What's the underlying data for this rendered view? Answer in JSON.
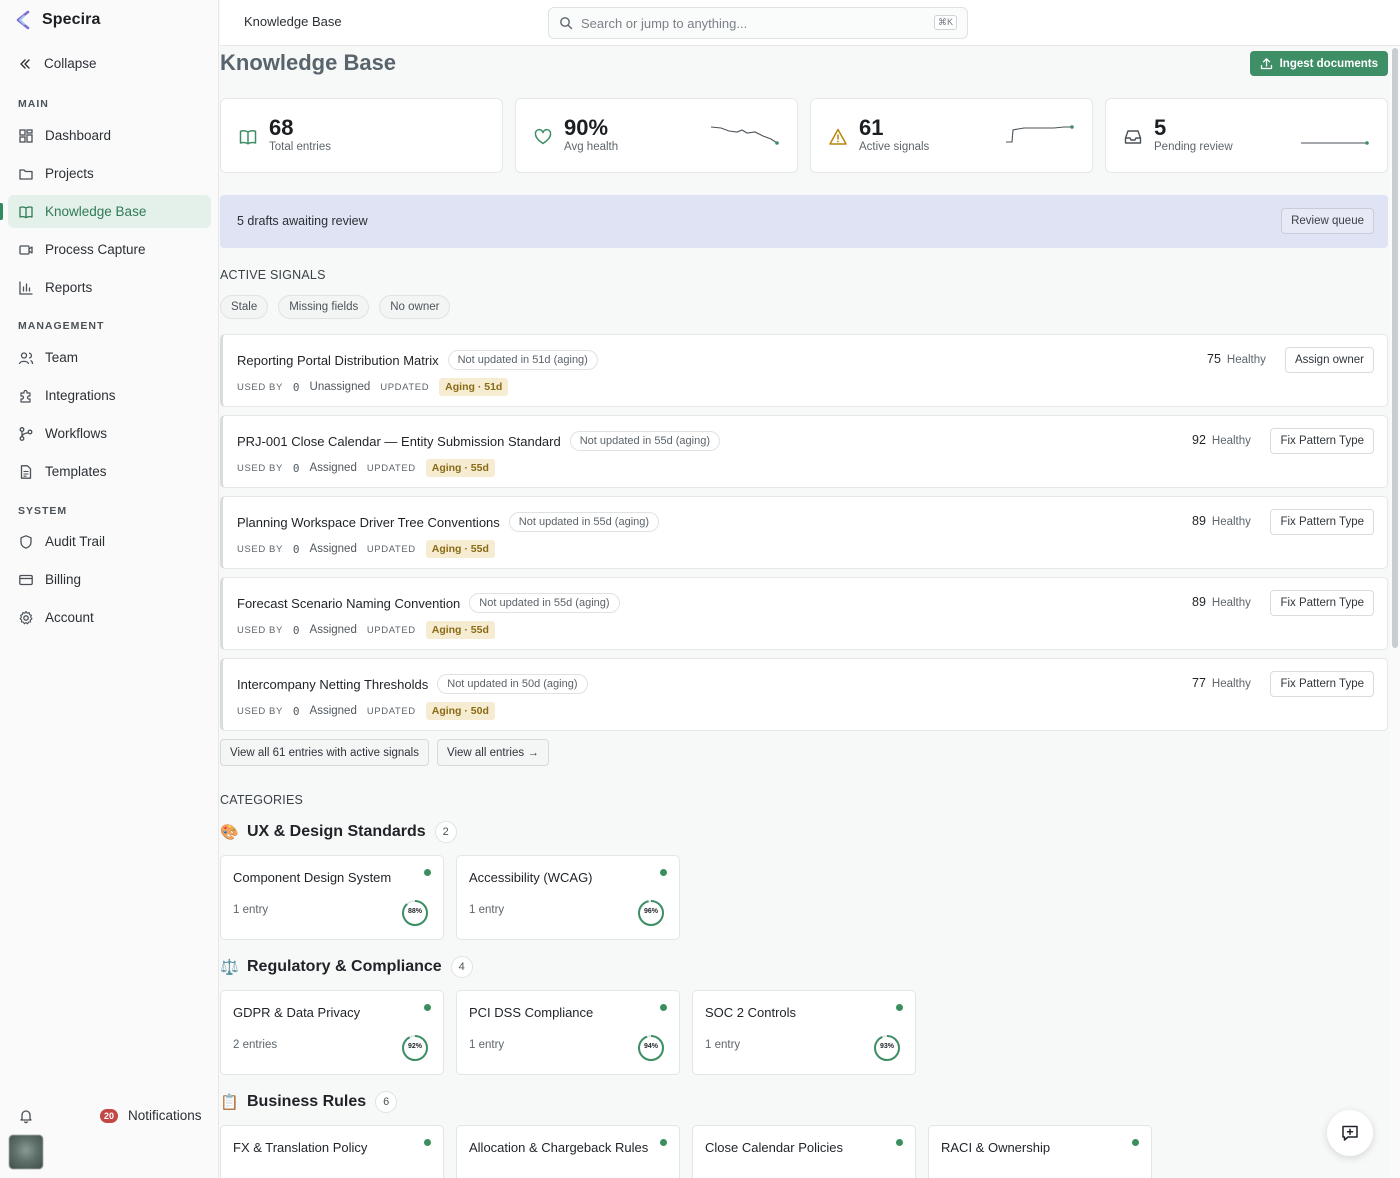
{
  "brand": {
    "name": "Specira"
  },
  "sidebar": {
    "collapse_label": "Collapse",
    "sections": {
      "main": "MAIN",
      "management": "MANAGEMENT",
      "system": "SYSTEM"
    },
    "items": [
      {
        "label": "Dashboard",
        "icon": "dashboard-icon"
      },
      {
        "label": "Projects",
        "icon": "folder-icon"
      },
      {
        "label": "Knowledge Base",
        "icon": "book-icon",
        "active": true
      },
      {
        "label": "Process Capture",
        "icon": "video-icon"
      },
      {
        "label": "Reports",
        "icon": "bar-chart-icon"
      },
      {
        "label": "Team",
        "icon": "users-icon"
      },
      {
        "label": "Integrations",
        "icon": "puzzle-icon"
      },
      {
        "label": "Workflows",
        "icon": "workflow-icon"
      },
      {
        "label": "Templates",
        "icon": "document-icon"
      },
      {
        "label": "Audit Trail",
        "icon": "shield-icon"
      },
      {
        "label": "Billing",
        "icon": "credit-card-icon"
      },
      {
        "label": "Account",
        "icon": "gear-icon"
      }
    ],
    "notifications": {
      "count": "20",
      "label": "Notifications"
    }
  },
  "topbar": {
    "breadcrumb": "Knowledge Base",
    "search_placeholder": "Search or jump to anything...",
    "search_shortcut": "⌘K"
  },
  "page": {
    "title": "Knowledge Base",
    "ingest_label": "Ingest documents"
  },
  "stats": [
    {
      "value": "68",
      "label": "Total entries",
      "icon": "book-icon"
    },
    {
      "value": "90%",
      "label": "Avg health",
      "icon": "heart-icon"
    },
    {
      "value": "61",
      "label": "Active signals",
      "icon": "warning-icon"
    },
    {
      "value": "5",
      "label": "Pending review",
      "icon": "inbox-icon"
    }
  ],
  "banner": {
    "text": "5 drafts awaiting review",
    "button": "Review queue"
  },
  "signals": {
    "heading": "ACTIVE SIGNALS",
    "filters": [
      "Stale",
      "Missing fields",
      "No owner"
    ],
    "used_by_label": "USED BY",
    "updated_label": "UPDATED",
    "rows": [
      {
        "title": "Reporting Portal Distribution Matrix",
        "pill": "Not updated in 51d (aging)",
        "used_by": "0",
        "owner": "Unassigned",
        "age": "Aging · 51d",
        "score": "75",
        "health": "Healthy",
        "action": "Assign owner"
      },
      {
        "title": "PRJ-001 Close Calendar — Entity Submission Standard",
        "pill": "Not updated in 55d (aging)",
        "used_by": "0",
        "owner": "Assigned",
        "age": "Aging · 55d",
        "score": "92",
        "health": "Healthy",
        "action": "Fix Pattern Type"
      },
      {
        "title": "Planning Workspace Driver Tree Conventions",
        "pill": "Not updated in 55d (aging)",
        "used_by": "0",
        "owner": "Assigned",
        "age": "Aging · 55d",
        "score": "89",
        "health": "Healthy",
        "action": "Fix Pattern Type"
      },
      {
        "title": "Forecast Scenario Naming Convention",
        "pill": "Not updated in 55d (aging)",
        "used_by": "0",
        "owner": "Assigned",
        "age": "Aging · 55d",
        "score": "89",
        "health": "Healthy",
        "action": "Fix Pattern Type"
      },
      {
        "title": "Intercompany Netting Thresholds",
        "pill": "Not updated in 50d (aging)",
        "used_by": "0",
        "owner": "Assigned",
        "age": "Aging · 50d",
        "score": "77",
        "health": "Healthy",
        "action": "Fix Pattern Type"
      }
    ],
    "view_signals": "View all 61 entries with active signals",
    "view_all": "View all entries →"
  },
  "categories": {
    "heading": "CATEGORIES",
    "groups": [
      {
        "emoji": "🎨",
        "name": "UX & Design Standards",
        "count": "2",
        "cards": [
          {
            "name": "Component Design System",
            "entries": "1 entry",
            "health": "88%",
            "pct": 88
          },
          {
            "name": "Accessibility (WCAG)",
            "entries": "1 entry",
            "health": "96%",
            "pct": 96
          }
        ]
      },
      {
        "emoji": "⚖️",
        "name": "Regulatory & Compliance",
        "count": "4",
        "cards": [
          {
            "name": "GDPR & Data Privacy",
            "entries": "2 entries",
            "health": "92%",
            "pct": 92
          },
          {
            "name": "PCI DSS Compliance",
            "entries": "1 entry",
            "health": "94%",
            "pct": 94
          },
          {
            "name": "SOC 2 Controls",
            "entries": "1 entry",
            "health": "93%",
            "pct": 93
          }
        ]
      },
      {
        "emoji": "📋",
        "name": "Business Rules",
        "count": "6",
        "cards": [
          {
            "name": "FX & Translation Policy"
          },
          {
            "name": "Allocation & Chargeback Rules"
          },
          {
            "name": "Close Calendar Policies"
          },
          {
            "name": "RACI & Ownership"
          }
        ]
      }
    ]
  },
  "colors": {
    "accent": "#3e8e66",
    "active_bg": "#e4f1ea",
    "banner_bg": "#dfe3f3",
    "aging_bg": "#f5ecd2",
    "aging_text": "#8a6a14",
    "status_dot": "#3b8f5f"
  }
}
